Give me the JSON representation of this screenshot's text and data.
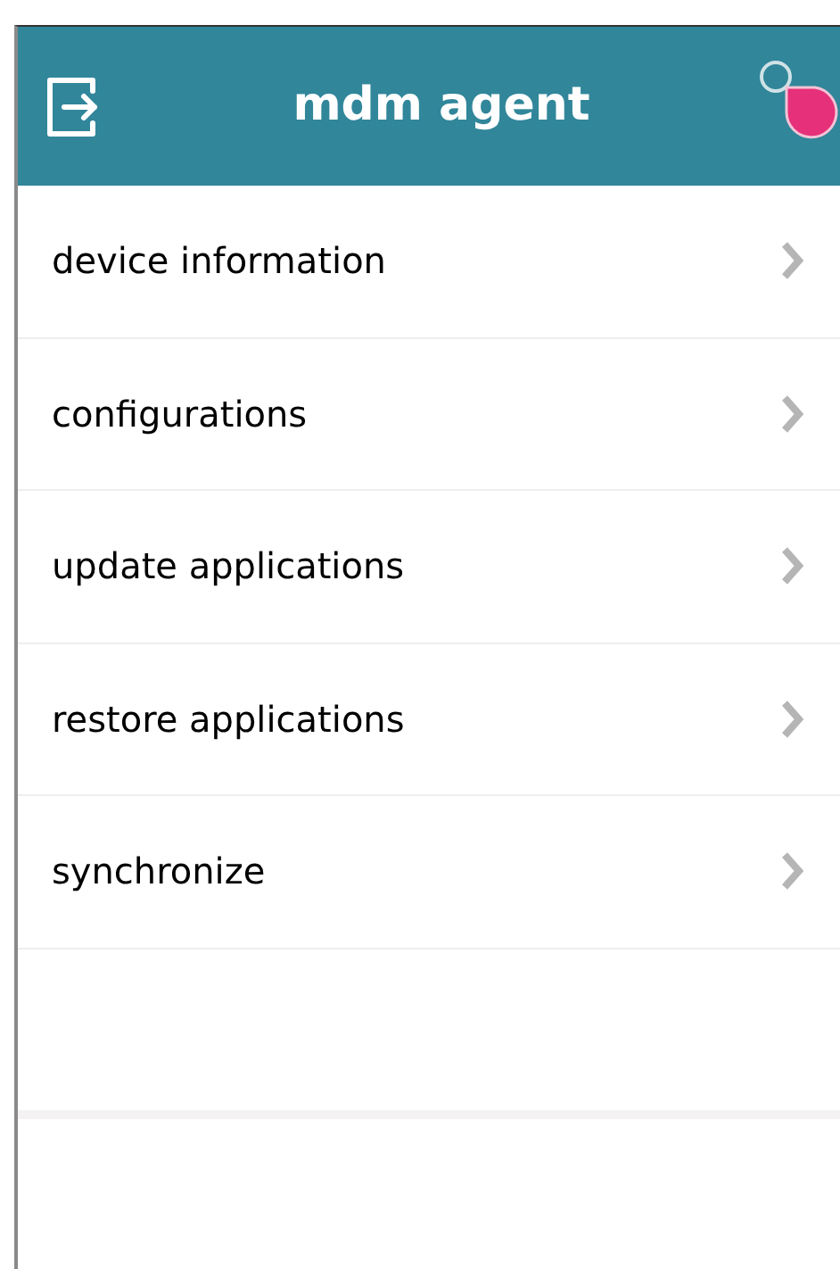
{
  "header": {
    "title": "mdm agent"
  },
  "menu": [
    {
      "label": "device information"
    },
    {
      "label": "configurations"
    },
    {
      "label": "update applications"
    },
    {
      "label": "restore applications"
    },
    {
      "label": "synchronize"
    }
  ]
}
